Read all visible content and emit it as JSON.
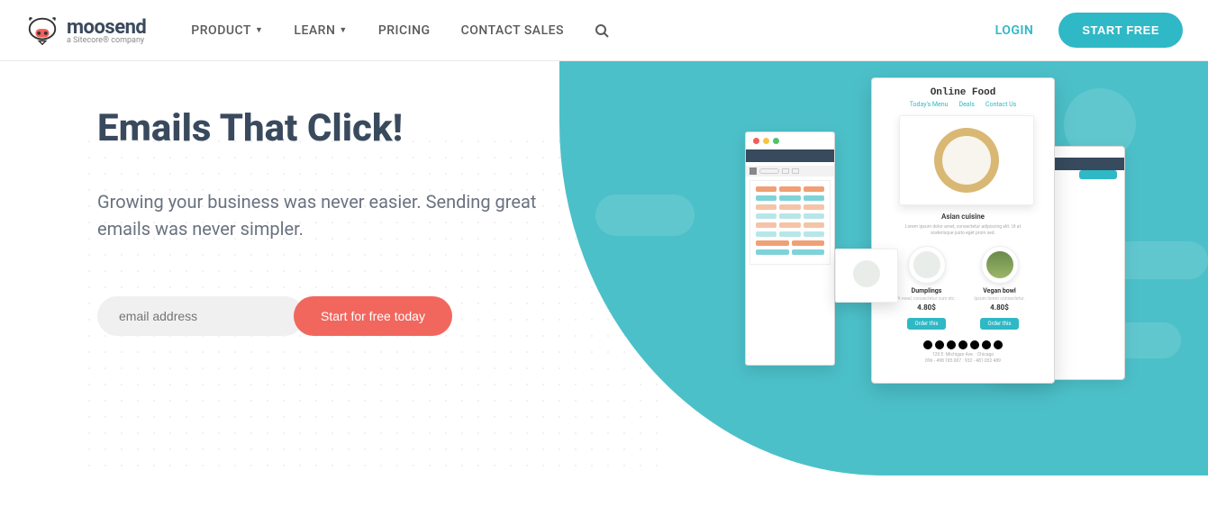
{
  "header": {
    "logo_name": "moosend",
    "logo_tagline": "a Sitecore® company",
    "nav": [
      {
        "label": "PRODUCT",
        "dropdown": true
      },
      {
        "label": "LEARN",
        "dropdown": true
      },
      {
        "label": "PRICING",
        "dropdown": false
      },
      {
        "label": "CONTACT SALES",
        "dropdown": false
      }
    ],
    "login_label": "LOGIN",
    "start_free_label": "START FREE"
  },
  "hero": {
    "title": "Emails That Click!",
    "subtitle": "Growing your business was never easier. Sending great emails was never simpler.",
    "email_placeholder": "email address",
    "cta_label": "Start for free today"
  },
  "mockup": {
    "site_title": "Online Food",
    "nav_items": [
      "Today's Menu",
      "Deals",
      "Contact Us"
    ],
    "hero_label": "Asian cuisine",
    "hero_desc": "Lorem ipsum dolor amet, consectetur adipiscing elit. Ut at scelerisque justo eget proin sed.",
    "products": [
      {
        "name": "Dumplings",
        "desc": "A meal, consectetur cum etc.",
        "price": "4.80$",
        "btn": "Order this"
      },
      {
        "name": "Vegan bowl",
        "desc": "Ipsum lorem consectetur.",
        "price": "4.80$",
        "btn": "Order this"
      }
    ],
    "footer_line1": "120 E. Michigan Ave. · Chicago",
    "footer_line2": "096 - 498 185 007 · 932 - 481 032 489"
  }
}
